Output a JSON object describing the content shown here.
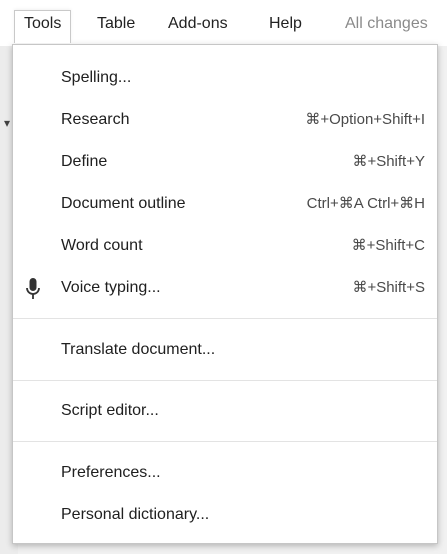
{
  "menubar": {
    "items": [
      {
        "label": "Tools"
      },
      {
        "label": "Table"
      },
      {
        "label": "Add-ons"
      },
      {
        "label": "Help"
      }
    ],
    "status": "All changes"
  },
  "dropdown": {
    "items": [
      {
        "label": "Spelling...",
        "shortcut": ""
      },
      {
        "label": "Research",
        "shortcut": "⌘+Option+Shift+I"
      },
      {
        "label": "Define",
        "shortcut": "⌘+Shift+Y"
      },
      {
        "label": "Document outline",
        "shortcut": "Ctrl+⌘A Ctrl+⌘H"
      },
      {
        "label": "Word count",
        "shortcut": "⌘+Shift+C"
      },
      {
        "label": "Voice typing...",
        "shortcut": "⌘+Shift+S",
        "icon": "microphone-icon"
      },
      {
        "label": "Translate document...",
        "shortcut": ""
      },
      {
        "label": "Script editor...",
        "shortcut": ""
      },
      {
        "label": "Preferences...",
        "shortcut": ""
      },
      {
        "label": "Personal dictionary...",
        "shortcut": ""
      }
    ]
  }
}
